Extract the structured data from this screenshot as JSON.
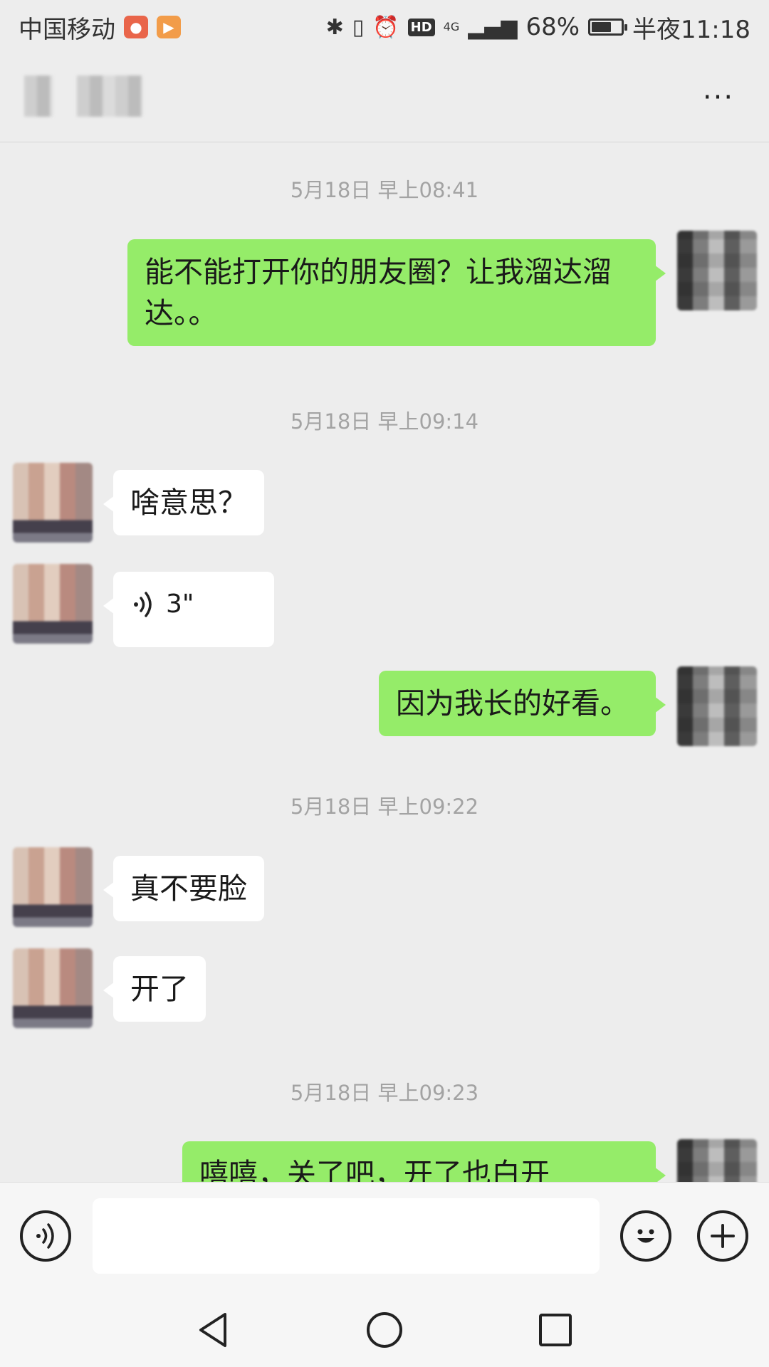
{
  "status_bar": {
    "carrier": "中国移动",
    "network": "4G",
    "battery": "68%",
    "battery_level": 0.68,
    "time": "半夜11:18",
    "icons": [
      "bluetooth-icon",
      "vibrate-icon",
      "alarm-icon",
      "hd-icon",
      "signal-icon",
      "battery-icon"
    ]
  },
  "header": {
    "more_label": "···"
  },
  "messages": [
    {
      "type": "time",
      "text": "5月18日 早上08:41"
    },
    {
      "type": "text",
      "from": "me",
      "text": "能不能打开你的朋友圈？让我溜达溜达。。"
    },
    {
      "type": "time",
      "text": "5月18日 早上09:14"
    },
    {
      "type": "text",
      "from": "them",
      "text": "啥意思？"
    },
    {
      "type": "voice",
      "from": "them",
      "duration": "3\""
    },
    {
      "type": "text",
      "from": "me",
      "text": "因为我长的好看。"
    },
    {
      "type": "time",
      "text": "5月18日 早上09:22"
    },
    {
      "type": "text",
      "from": "them",
      "text": "真不要脸"
    },
    {
      "type": "text",
      "from": "them",
      "text": "开了"
    },
    {
      "type": "time",
      "text": "5月18日 早上09:23"
    },
    {
      "type": "text",
      "from": "me",
      "text": "嘻嘻，关了吧，开了也白开"
    }
  ],
  "input_bar": {
    "voice_icon": "voice-icon",
    "emoji_icon": "emoji-icon",
    "plus_icon": "plus-icon",
    "placeholder": ""
  },
  "colors": {
    "me_bubble": "#95ec69",
    "them_bubble": "#ffffff",
    "background": "#ededed",
    "timestamp": "#a3a3a3"
  }
}
